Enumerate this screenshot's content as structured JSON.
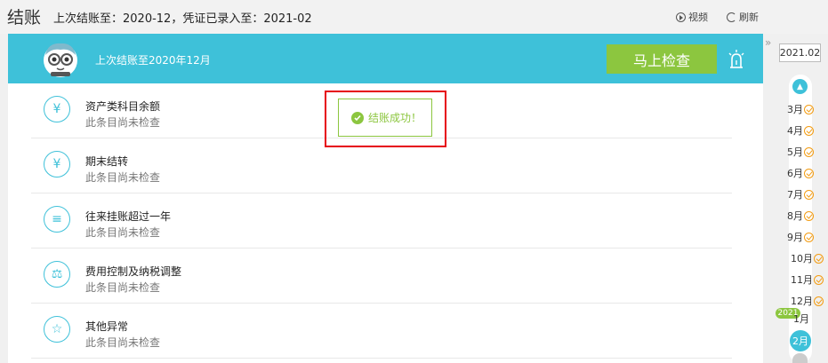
{
  "header": {
    "title": "结账",
    "period_info": "上次结账至：2020-12，凭证已录入至：2021-02",
    "video_label": "视频",
    "refresh_label": "刷新"
  },
  "banner": {
    "text": "上次结账至2020年12月",
    "check_button_label": "马上检查"
  },
  "checks": [
    {
      "icon": "¥",
      "title": "资产类科目余额",
      "status": "此条目尚未检查"
    },
    {
      "icon": "¥",
      "title": "期末结转",
      "status": "此条目尚未检查"
    },
    {
      "icon": "≡",
      "title": "往来挂账超过一年",
      "status": "此条目尚未检查"
    },
    {
      "icon": "⚖",
      "title": "费用控制及纳税调整",
      "status": "此条目尚未检查"
    },
    {
      "icon": "☆",
      "title": "其他异常",
      "status": "此条目尚未检查"
    }
  ],
  "toast": {
    "message": "结账成功！"
  },
  "sidebar": {
    "current_period": "2021.02",
    "months": [
      "3月",
      "4月",
      "5月",
      "6月",
      "7月",
      "8月",
      "9月",
      "10月",
      "11月",
      "12月"
    ],
    "year_badge": "2021",
    "jan_label": "1月",
    "selected_month": "2月"
  },
  "colors": {
    "accent": "#3ec1d9",
    "success": "#8cc63f",
    "highlight": "#e60012",
    "check": "#f39c12"
  }
}
